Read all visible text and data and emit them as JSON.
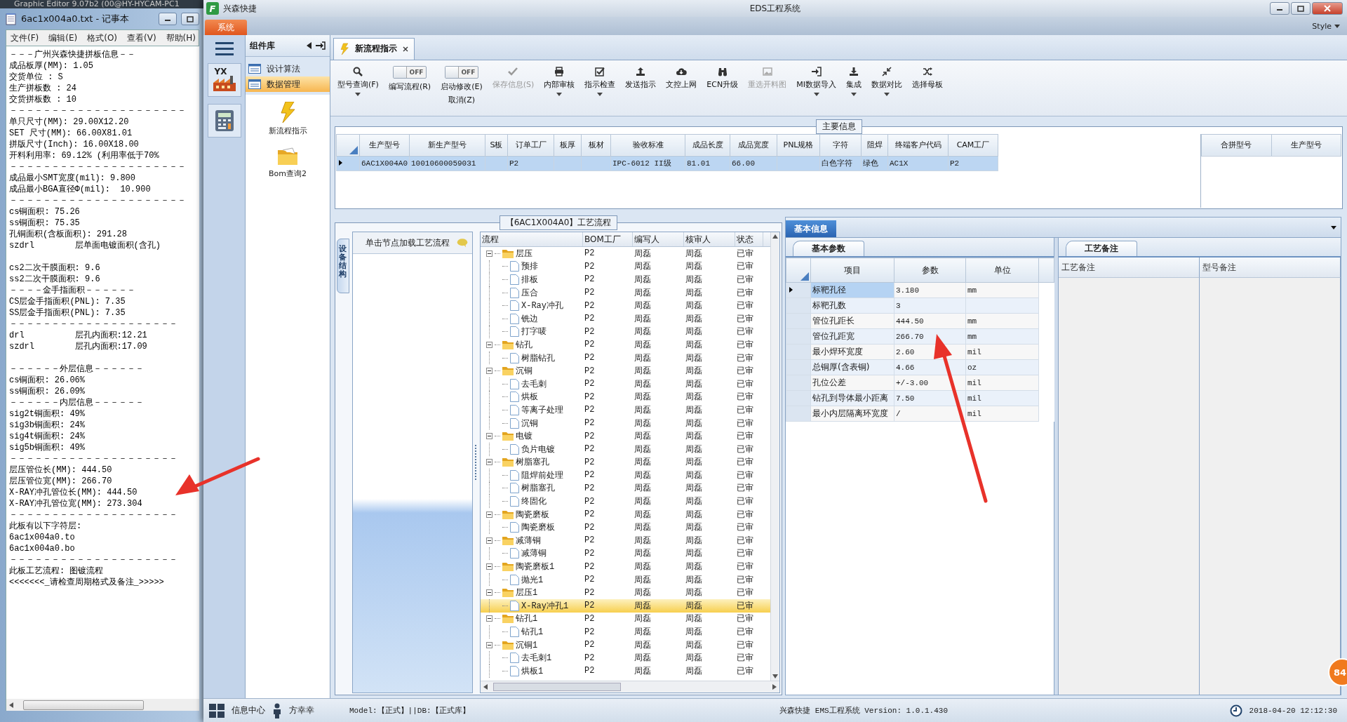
{
  "background_window": {
    "title": "Graphic Editor 9.07b2 (00@HY-HYCAM-PC1"
  },
  "notepad": {
    "title": "6ac1x004a0.txt - 记事本",
    "menu": [
      "文件(F)",
      "编辑(E)",
      "格式(O)",
      "查看(V)",
      "帮助(H)"
    ],
    "paragraphs": [
      [
        "－－－广州兴森快捷拼板信息－－",
        "成品板厚(MM): 1.05",
        "交货单位 : S",
        "生产拼板数 : 24",
        "交货拼板数 : 10",
        "－－－－－－－－－－－－－－－－－－－－－",
        "单只尺寸(MM): 29.00X12.20",
        "SET 尺寸(MM): 66.00X81.01",
        "拼版尺寸(Inch): 16.00X18.00",
        "开料利用率: 69.12% (利用率低于70%",
        "－－－－－－－－－－－－－－－－－－－－－",
        "成品最小SMT宽度(mil): 9.800",
        "成品最小BGA直径Φ(mil):  10.900",
        "－－－－－－－－－－－－－－－－－－－－－",
        "cs铜面积: 75.26",
        "ss铜面积: 75.35",
        "孔铜面积(含板面积): 291.28",
        "szdrl        层单面电镀面积(含孔)"
      ],
      [
        "cs2二次干膜面积: 9.6",
        "ss2二次干膜面积: 9.6",
        "－－－－金手指面积－－－－－－",
        "CS层金手指面积(PNL): 7.35",
        "SS层金手指面积(PNL): 7.35",
        "－－－－－－－－－－－－－－－－－－－－",
        "drl          层孔内面积:12.21",
        "szdrl        层孔内面积:17.09"
      ],
      [
        "－－－－－－外层信息－－－－－－",
        "cs铜面积: 26.06%",
        "ss铜面积: 26.09%",
        "－－－－－－内层信息－－－－－－",
        "sig2t铜面积: 49%",
        "sig3b铜面积: 24%",
        "sig4t铜面积: 24%",
        "sig5b铜面积: 49%",
        "－－－－－－－－－－－－－－－－－－－－",
        "层压管位长(MM): 444.50",
        "层压管位宽(MM): 266.70",
        "X-RAY冲孔管位长(MM): 444.50",
        "X-RAY冲孔管位宽(MM): 273.304",
        "－－－－－－－－－－－－－－－－－－－－",
        "此板有以下字符层:",
        "6ac1x004a0.to",
        "6ac1x004a0.bo",
        "－－－－－－－－－－－－－－－－－－－－",
        "此板工艺流程: 图镀流程",
        "<<<<<<<_请检查周期格式及备注_>>>>>"
      ]
    ]
  },
  "app": {
    "logo": "F",
    "brand": "兴森快捷",
    "title": "EDS工程系统",
    "ribbon_tab": "系统",
    "style_menu": "Style"
  },
  "nav": {
    "logo_text": "YX"
  },
  "component_panel": {
    "title": "组件库",
    "items": [
      {
        "label": "设计算法",
        "selected": false
      },
      {
        "label": "数据管理",
        "selected": true
      }
    ],
    "launchers": [
      {
        "kind": "lightning",
        "label": "新流程指示"
      },
      {
        "kind": "folder",
        "label": "Bom查询2"
      }
    ]
  },
  "doc_tabs": [
    {
      "label": "新流程指示",
      "selected": true
    }
  ],
  "toolbar": [
    {
      "kind": "button",
      "label": "型号查询(F)",
      "dropdown": true,
      "disabled": false
    },
    {
      "kind": "toggle",
      "label": "编写流程(R)",
      "state": "OFF",
      "on": false
    },
    {
      "kind": "toggle",
      "label": "启动修改(E)",
      "sublabel": "取消(Z)",
      "state": "OFF",
      "on": false
    },
    {
      "kind": "button",
      "label": "保存信息(S)",
      "dropdown": false,
      "disabled": true
    },
    {
      "kind": "button",
      "label": "内部审核",
      "dropdown": true,
      "disabled": false
    },
    {
      "kind": "button",
      "label": "指示检查",
      "dropdown": true,
      "disabled": false
    },
    {
      "kind": "button",
      "label": "发送指示",
      "dropdown": false,
      "disabled": false
    },
    {
      "kind": "button",
      "label": "文控上网",
      "dropdown": false,
      "disabled": false
    },
    {
      "kind": "button",
      "label": "ECN升级",
      "dropdown": false,
      "disabled": false
    },
    {
      "kind": "button",
      "label": "重选开料图",
      "dropdown": false,
      "disabled": true
    },
    {
      "kind": "button",
      "label": "MI数据导入",
      "dropdown": true,
      "disabled": false
    },
    {
      "kind": "button",
      "label": "集成",
      "dropdown": true,
      "disabled": false
    },
    {
      "kind": "button",
      "label": "数据对比",
      "dropdown": true,
      "disabled": false
    },
    {
      "kind": "button",
      "label": "选择母板",
      "dropdown": false,
      "disabled": false
    }
  ],
  "main_info": {
    "title": "主要信息",
    "columns": [
      "生产型号",
      "新生产型号",
      "S板",
      "订单工厂",
      "板厚",
      "板材",
      "验收标准",
      "成品长度",
      "成品宽度",
      "PNL规格",
      "字符",
      "阻焊",
      "终端客户代码",
      "CAM工厂"
    ],
    "rows": [
      {
        "selected": true,
        "cells": [
          "6AC1X004A0",
          "10010600059031",
          null,
          "P2",
          null,
          null,
          "IPC-6012 II级",
          "81.01",
          "66.00",
          null,
          "白色字符",
          "绿色",
          "AC1X",
          "P2"
        ]
      }
    ],
    "merge_columns": [
      "合拼型号",
      "生产型号"
    ]
  },
  "flow": {
    "title": "【6AC1X004A0】工艺流程",
    "side_tab": "设备结构",
    "hint": "单击节点加载工艺流程",
    "columns": [
      "流程",
      "BOM工厂",
      "编写人",
      "核审人",
      "状态"
    ],
    "nodes": [
      {
        "label": "层压",
        "plant": "P2",
        "writer": "周磊",
        "reviewer": "周磊",
        "status": "已审",
        "selected": false,
        "expanded": true,
        "children": [
          {
            "label": "预排",
            "plant": "P2",
            "writer": "周磊",
            "reviewer": "周磊",
            "status": "已审",
            "selected": false
          },
          {
            "label": "排板",
            "plant": "P2",
            "writer": "周磊",
            "reviewer": "周磊",
            "status": "已审",
            "selected": false
          },
          {
            "label": "压合",
            "plant": "P2",
            "writer": "周磊",
            "reviewer": "周磊",
            "status": "已审",
            "selected": false
          },
          {
            "label": "X-Ray冲孔",
            "plant": "P2",
            "writer": "周磊",
            "reviewer": "周磊",
            "status": "已审",
            "selected": false
          },
          {
            "label": "铣边",
            "plant": "P2",
            "writer": "周磊",
            "reviewer": "周磊",
            "status": "已审",
            "selected": false
          },
          {
            "label": "打字唛",
            "plant": "P2",
            "writer": "周磊",
            "reviewer": "周磊",
            "status": "已审",
            "selected": false
          }
        ]
      },
      {
        "label": "钻孔",
        "plant": "P2",
        "writer": "周磊",
        "reviewer": "周磊",
        "status": "已审",
        "selected": false,
        "expanded": true,
        "children": [
          {
            "label": "树脂钻孔",
            "plant": "P2",
            "writer": "周磊",
            "reviewer": "周磊",
            "status": "已审",
            "selected": false
          }
        ]
      },
      {
        "label": "沉铜",
        "plant": "P2",
        "writer": "周磊",
        "reviewer": "周磊",
        "status": "已审",
        "selected": false,
        "expanded": true,
        "children": [
          {
            "label": "去毛刺",
            "plant": "P2",
            "writer": "周磊",
            "reviewer": "周磊",
            "status": "已审",
            "selected": false
          },
          {
            "label": "烘板",
            "plant": "P2",
            "writer": "周磊",
            "reviewer": "周磊",
            "status": "已审",
            "selected": false
          },
          {
            "label": "等离子处理",
            "plant": "P2",
            "writer": "周磊",
            "reviewer": "周磊",
            "status": "已审",
            "selected": false
          },
          {
            "label": "沉铜",
            "plant": "P2",
            "writer": "周磊",
            "reviewer": "周磊",
            "status": "已审",
            "selected": false
          }
        ]
      },
      {
        "label": "电镀",
        "plant": "P2",
        "writer": "周磊",
        "reviewer": "周磊",
        "status": "已审",
        "selected": false,
        "expanded": true,
        "children": [
          {
            "label": "负片电镀",
            "plant": "P2",
            "writer": "周磊",
            "reviewer": "周磊",
            "status": "已审",
            "selected": false
          }
        ]
      },
      {
        "label": "树脂塞孔",
        "plant": "P2",
        "writer": "周磊",
        "reviewer": "周磊",
        "status": "已审",
        "selected": false,
        "expanded": true,
        "children": [
          {
            "label": "阻焊前处理",
            "plant": "P2",
            "writer": "周磊",
            "reviewer": "周磊",
            "status": "已审",
            "selected": false
          },
          {
            "label": "树脂塞孔",
            "plant": "P2",
            "writer": "周磊",
            "reviewer": "周磊",
            "status": "已审",
            "selected": false
          },
          {
            "label": "终固化",
            "plant": "P2",
            "writer": "周磊",
            "reviewer": "周磊",
            "status": "已审",
            "selected": false
          }
        ]
      },
      {
        "label": "陶瓷磨板",
        "plant": "P2",
        "writer": "周磊",
        "reviewer": "周磊",
        "status": "已审",
        "selected": false,
        "expanded": true,
        "children": [
          {
            "label": "陶瓷磨板",
            "plant": "P2",
            "writer": "周磊",
            "reviewer": "周磊",
            "status": "已审",
            "selected": false
          }
        ]
      },
      {
        "label": "减薄铜",
        "plant": "P2",
        "writer": "周磊",
        "reviewer": "周磊",
        "status": "已审",
        "selected": false,
        "expanded": true,
        "children": [
          {
            "label": "减薄铜",
            "plant": "P2",
            "writer": "周磊",
            "reviewer": "周磊",
            "status": "已审",
            "selected": false
          }
        ]
      },
      {
        "label": "陶瓷磨板1",
        "plant": "P2",
        "writer": "周磊",
        "reviewer": "周磊",
        "status": "已审",
        "selected": false,
        "expanded": true,
        "children": [
          {
            "label": "抛光1",
            "plant": "P2",
            "writer": "周磊",
            "reviewer": "周磊",
            "status": "已审",
            "selected": false
          }
        ]
      },
      {
        "label": "层压1",
        "plant": "P2",
        "writer": "周磊",
        "reviewer": "周磊",
        "status": "已审",
        "selected": false,
        "expanded": true,
        "children": [
          {
            "label": "X-Ray冲孔1",
            "plant": "P2",
            "writer": "周磊",
            "reviewer": "周磊",
            "status": "已审",
            "selected": true
          }
        ]
      },
      {
        "label": "钻孔1",
        "plant": "P2",
        "writer": "周磊",
        "reviewer": "周磊",
        "status": "已审",
        "selected": false,
        "expanded": true,
        "children": [
          {
            "label": "钻孔1",
            "plant": "P2",
            "writer": "周磊",
            "reviewer": "周磊",
            "status": "已审",
            "selected": false
          }
        ]
      },
      {
        "label": "沉铜1",
        "plant": "P2",
        "writer": "周磊",
        "reviewer": "周磊",
        "status": "已审",
        "selected": false,
        "expanded": true,
        "children": [
          {
            "label": "去毛刺1",
            "plant": "P2",
            "writer": "周磊",
            "reviewer": "周磊",
            "status": "已审",
            "selected": false
          },
          {
            "label": "烘板1",
            "plant": "P2",
            "writer": "周磊",
            "reviewer": "周磊",
            "status": "已审",
            "selected": false
          }
        ]
      }
    ]
  },
  "basic_info": {
    "tab": {
      "label": "基本信息",
      "selected": true
    },
    "params_tab": {
      "label": "基本参数",
      "selected": true
    },
    "columns": [
      "项目",
      "参数",
      "单位"
    ],
    "rows": [
      {
        "item": "标靶孔径",
        "value": "3.180",
        "unit": "mm",
        "selected": true
      },
      {
        "item": "标靶孔数",
        "value": "3",
        "selected": false
      },
      {
        "item": "管位孔距长",
        "value": "444.50",
        "unit": "mm",
        "selected": false
      },
      {
        "item": "管位孔距宽",
        "value": "266.70",
        "unit": "mm",
        "selected": false
      },
      {
        "item": "最小焊环宽度",
        "value": "2.60",
        "unit": "mil",
        "selected": false
      },
      {
        "item": "总铜厚(含表铜)",
        "value": "4.66",
        "unit": "oz",
        "selected": false
      },
      {
        "item": "孔位公差",
        "value": "+/-3.00",
        "unit": "mil",
        "selected": false
      },
      {
        "item": "钻孔到导体最小距离",
        "value": "7.50",
        "unit": "mil",
        "selected": false
      },
      {
        "item": "最小内层隔离环宽度",
        "value": "/",
        "unit": "mil",
        "selected": false
      }
    ],
    "notes_tab": {
      "label": "工艺备注",
      "selected": true
    },
    "notes_columns": [
      "工艺备注",
      "型号备注"
    ]
  },
  "status_bar": {
    "info_center": "信息中心",
    "user": "方幸幸",
    "db": "Model:【正式】||DB:【正式库】",
    "version": "兴森快捷 EMS工程系统 Version: 1.0.1.430",
    "datetime": "2018-04-20 12:12:30"
  },
  "badge": "84"
}
